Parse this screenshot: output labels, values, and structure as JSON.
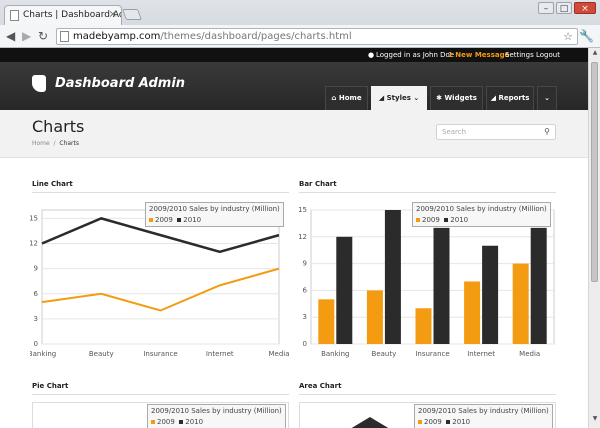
{
  "browser": {
    "tab_title": "Charts | Dashboard Admin",
    "url_host": "madebyamp.com",
    "url_path": "/themes/dashboard/pages/charts.html"
  },
  "topbar": {
    "logged_in": "Logged in as John Doe",
    "new_message": "1 New Message",
    "settings": "Settings",
    "logout": "Logout"
  },
  "header": {
    "brand": "Dashboard Admin",
    "nav": {
      "home": "Home",
      "styles": "Styles",
      "widgets": "Widgets",
      "reports": "Reports"
    }
  },
  "page": {
    "title": "Charts",
    "crumb_home": "Home",
    "crumb_current": "Charts",
    "search_placeholder": "Search"
  },
  "sections": {
    "line": "Line Chart",
    "bar": "Bar Chart",
    "pie": "Pie Chart",
    "area": "Area Chart"
  },
  "legend": {
    "title": "2009/2010 Sales by industry (Million)",
    "s2009": "2009",
    "s2010": "2010"
  },
  "colors": {
    "s2009": "#f39c12",
    "s2010": "#2b2b2b",
    "accent": "#f39c12"
  },
  "chart_data": [
    {
      "type": "line",
      "categories": [
        "Banking",
        "Beauty",
        "Insurance",
        "Internet",
        "Media"
      ],
      "series": [
        {
          "name": "2009",
          "values": [
            5,
            6,
            4,
            7,
            9
          ]
        },
        {
          "name": "2010",
          "values": [
            12,
            15,
            13,
            11,
            13
          ]
        }
      ],
      "yticks": [
        0,
        3,
        6,
        9,
        12,
        15
      ],
      "ylim": [
        0,
        16
      ],
      "legend_title": "2009/2010 Sales by industry (Million)",
      "legend_position": "top-right",
      "grid": true
    },
    {
      "type": "bar",
      "categories": [
        "Banking",
        "Beauty",
        "Insurance",
        "Internet",
        "Media"
      ],
      "series": [
        {
          "name": "2009",
          "values": [
            5,
            6,
            4,
            7,
            9
          ]
        },
        {
          "name": "2010",
          "values": [
            12,
            15,
            13,
            11,
            13
          ]
        }
      ],
      "yticks": [
        0,
        3,
        6,
        9,
        12,
        15
      ],
      "ylim": [
        0,
        15
      ],
      "legend_title": "2009/2010 Sales by industry (Million)",
      "legend_position": "top-right",
      "grid": true
    }
  ]
}
